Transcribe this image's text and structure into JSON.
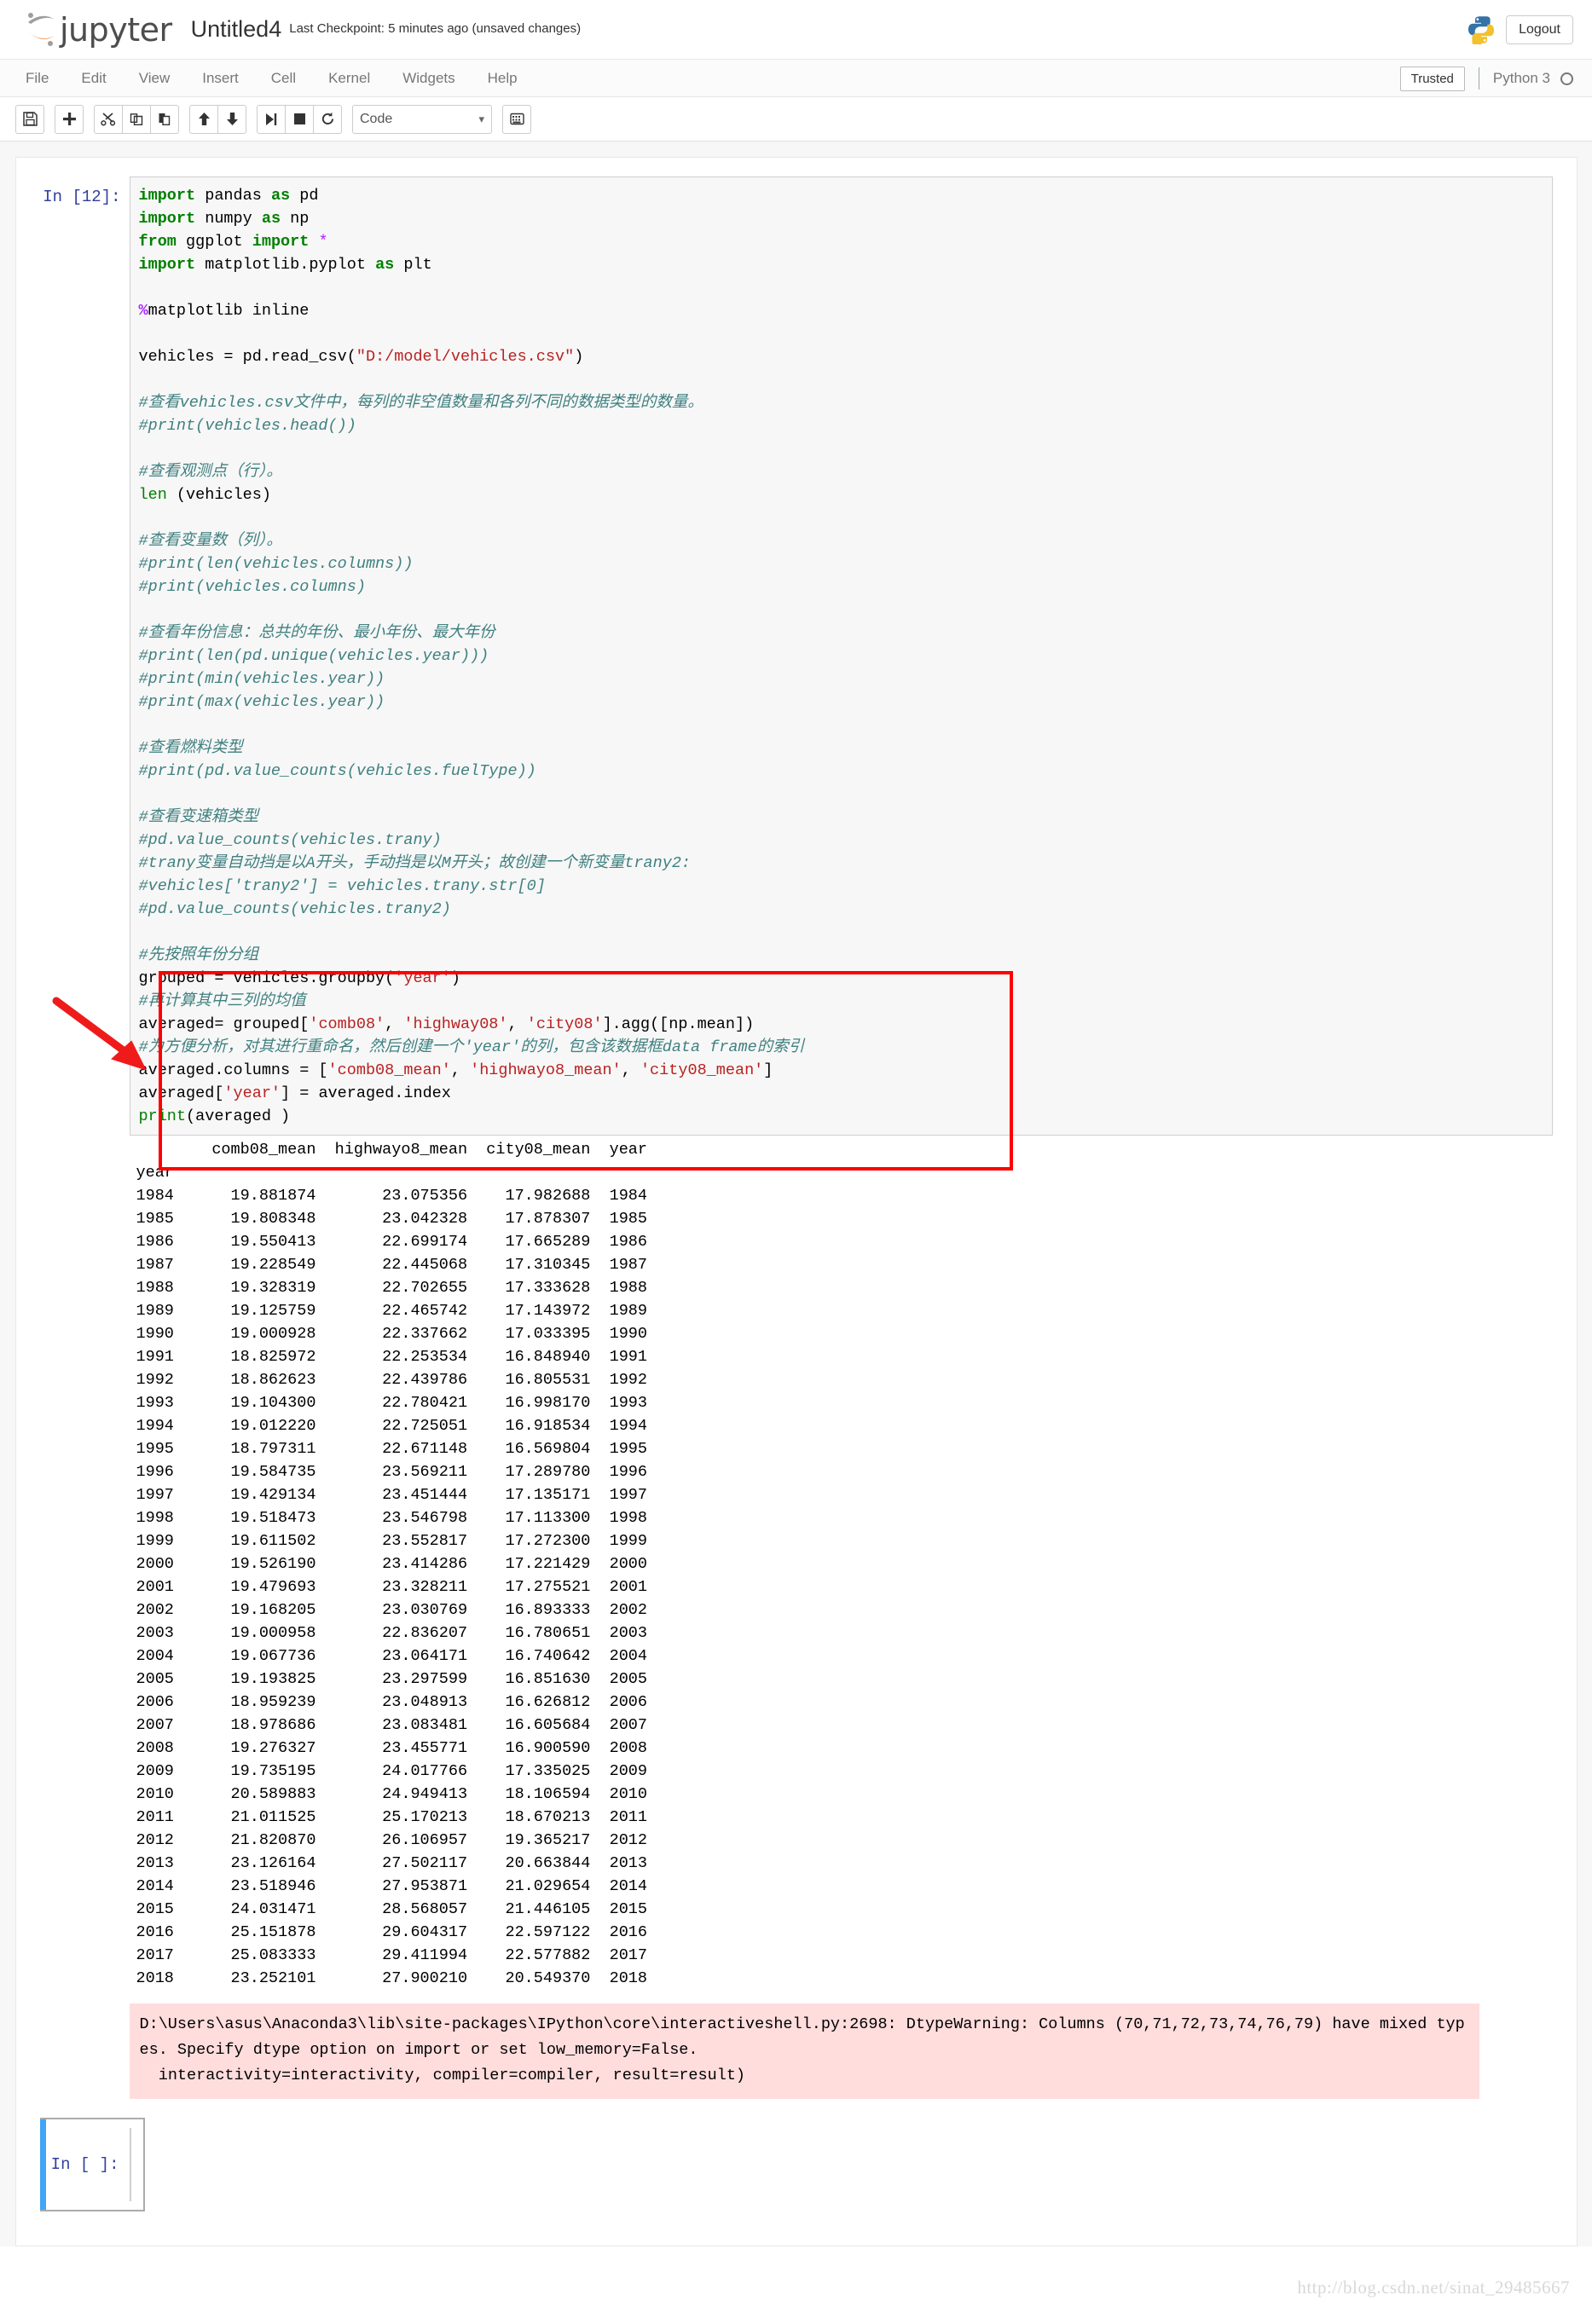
{
  "header": {
    "brand": "jupyter",
    "notebook_name": "Untitled4",
    "checkpoint": "Last Checkpoint: 5 minutes ago (unsaved changes)",
    "logout_label": "Logout"
  },
  "menubar": {
    "items": [
      "File",
      "Edit",
      "View",
      "Insert",
      "Cell",
      "Kernel",
      "Widgets",
      "Help"
    ],
    "trusted_label": "Trusted",
    "kernel_label": "Python 3"
  },
  "toolbar": {
    "cell_type": "Code",
    "icons": [
      "save-icon",
      "add-cell-icon",
      "cut-icon",
      "copy-icon",
      "paste-icon",
      "move-up-icon",
      "move-down-icon",
      "run-icon",
      "stop-icon",
      "restart-icon",
      "command-palette-icon"
    ]
  },
  "cells": [
    {
      "prompt": "In [12]:",
      "source_lines": [
        {
          "t": "kw",
          "v": "import"
        },
        {
          "t": "p",
          "v": " pandas "
        },
        {
          "t": "kw",
          "v": "as"
        },
        {
          "t": "p",
          "v": " pd"
        }
      ]
    }
  ],
  "code": {
    "prompt_in_12": "In [12]:",
    "prompt_empty": "In [ ]:"
  },
  "output": {
    "table_header": "        comb08_mean  highwayo8_mean  city08_mean  year",
    "index_label": "year",
    "columns": [
      "comb08_mean",
      "highwayo8_mean",
      "city08_mean",
      "year"
    ],
    "rows": [
      {
        "year": "1984",
        "comb08_mean": "19.881874",
        "highwayo8_mean": "23.075356",
        "city08_mean": "17.982688",
        "year_col": "1984"
      },
      {
        "year": "1985",
        "comb08_mean": "19.808348",
        "highwayo8_mean": "23.042328",
        "city08_mean": "17.878307",
        "year_col": "1985"
      },
      {
        "year": "1986",
        "comb08_mean": "19.550413",
        "highwayo8_mean": "22.699174",
        "city08_mean": "17.665289",
        "year_col": "1986"
      },
      {
        "year": "1987",
        "comb08_mean": "19.228549",
        "highwayo8_mean": "22.445068",
        "city08_mean": "17.310345",
        "year_col": "1987"
      },
      {
        "year": "1988",
        "comb08_mean": "19.328319",
        "highwayo8_mean": "22.702655",
        "city08_mean": "17.333628",
        "year_col": "1988"
      },
      {
        "year": "1989",
        "comb08_mean": "19.125759",
        "highwayo8_mean": "22.465742",
        "city08_mean": "17.143972",
        "year_col": "1989"
      },
      {
        "year": "1990",
        "comb08_mean": "19.000928",
        "highwayo8_mean": "22.337662",
        "city08_mean": "17.033395",
        "year_col": "1990"
      },
      {
        "year": "1991",
        "comb08_mean": "18.825972",
        "highwayo8_mean": "22.253534",
        "city08_mean": "16.848940",
        "year_col": "1991"
      },
      {
        "year": "1992",
        "comb08_mean": "18.862623",
        "highwayo8_mean": "22.439786",
        "city08_mean": "16.805531",
        "year_col": "1992"
      },
      {
        "year": "1993",
        "comb08_mean": "19.104300",
        "highwayo8_mean": "22.780421",
        "city08_mean": "16.998170",
        "year_col": "1993"
      },
      {
        "year": "1994",
        "comb08_mean": "19.012220",
        "highwayo8_mean": "22.725051",
        "city08_mean": "16.918534",
        "year_col": "1994"
      },
      {
        "year": "1995",
        "comb08_mean": "18.797311",
        "highwayo8_mean": "22.671148",
        "city08_mean": "16.569804",
        "year_col": "1995"
      },
      {
        "year": "1996",
        "comb08_mean": "19.584735",
        "highwayo8_mean": "23.569211",
        "city08_mean": "17.289780",
        "year_col": "1996"
      },
      {
        "year": "1997",
        "comb08_mean": "19.429134",
        "highwayo8_mean": "23.451444",
        "city08_mean": "17.135171",
        "year_col": "1997"
      },
      {
        "year": "1998",
        "comb08_mean": "19.518473",
        "highwayo8_mean": "23.546798",
        "city08_mean": "17.113300",
        "year_col": "1998"
      },
      {
        "year": "1999",
        "comb08_mean": "19.611502",
        "highwayo8_mean": "23.552817",
        "city08_mean": "17.272300",
        "year_col": "1999"
      },
      {
        "year": "2000",
        "comb08_mean": "19.526190",
        "highwayo8_mean": "23.414286",
        "city08_mean": "17.221429",
        "year_col": "2000"
      },
      {
        "year": "2001",
        "comb08_mean": "19.479693",
        "highwayo8_mean": "23.328211",
        "city08_mean": "17.275521",
        "year_col": "2001"
      },
      {
        "year": "2002",
        "comb08_mean": "19.168205",
        "highwayo8_mean": "23.030769",
        "city08_mean": "16.893333",
        "year_col": "2002"
      },
      {
        "year": "2003",
        "comb08_mean": "19.000958",
        "highwayo8_mean": "22.836207",
        "city08_mean": "16.780651",
        "year_col": "2003"
      },
      {
        "year": "2004",
        "comb08_mean": "19.067736",
        "highwayo8_mean": "23.064171",
        "city08_mean": "16.740642",
        "year_col": "2004"
      },
      {
        "year": "2005",
        "comb08_mean": "19.193825",
        "highwayo8_mean": "23.297599",
        "city08_mean": "16.851630",
        "year_col": "2005"
      },
      {
        "year": "2006",
        "comb08_mean": "18.959239",
        "highwayo8_mean": "23.048913",
        "city08_mean": "16.626812",
        "year_col": "2006"
      },
      {
        "year": "2007",
        "comb08_mean": "18.978686",
        "highwayo8_mean": "23.083481",
        "city08_mean": "16.605684",
        "year_col": "2007"
      },
      {
        "year": "2008",
        "comb08_mean": "19.276327",
        "highwayo8_mean": "23.455771",
        "city08_mean": "16.900590",
        "year_col": "2008"
      },
      {
        "year": "2009",
        "comb08_mean": "19.735195",
        "highwayo8_mean": "24.017766",
        "city08_mean": "17.335025",
        "year_col": "2009"
      },
      {
        "year": "2010",
        "comb08_mean": "20.589883",
        "highwayo8_mean": "24.949413",
        "city08_mean": "18.106594",
        "year_col": "2010"
      },
      {
        "year": "2011",
        "comb08_mean": "21.011525",
        "highwayo8_mean": "25.170213",
        "city08_mean": "18.670213",
        "year_col": "2011"
      },
      {
        "year": "2012",
        "comb08_mean": "21.820870",
        "highwayo8_mean": "26.106957",
        "city08_mean": "19.365217",
        "year_col": "2012"
      },
      {
        "year": "2013",
        "comb08_mean": "23.126164",
        "highwayo8_mean": "27.502117",
        "city08_mean": "20.663844",
        "year_col": "2013"
      },
      {
        "year": "2014",
        "comb08_mean": "23.518946",
        "highwayo8_mean": "27.953871",
        "city08_mean": "21.029654",
        "year_col": "2014"
      },
      {
        "year": "2015",
        "comb08_mean": "24.031471",
        "highwayo8_mean": "28.568057",
        "city08_mean": "21.446105",
        "year_col": "2015"
      },
      {
        "year": "2016",
        "comb08_mean": "25.151878",
        "highwayo8_mean": "29.604317",
        "city08_mean": "22.597122",
        "year_col": "2016"
      },
      {
        "year": "2017",
        "comb08_mean": "25.083333",
        "highwayo8_mean": "29.411994",
        "city08_mean": "22.577882",
        "year_col": "2017"
      },
      {
        "year": "2018",
        "comb08_mean": "23.252101",
        "highwayo8_mean": "27.900210",
        "city08_mean": "20.549370",
        "year_col": "2018"
      }
    ],
    "stdout_text": "        comb08_mean  highwayo8_mean  city08_mean  year\nyear                                                    \n1984      19.881874       23.075356    17.982688  1984\n1985      19.808348       23.042328    17.878307  1985\n1986      19.550413       22.699174    17.665289  1986\n1987      19.228549       22.445068    17.310345  1987\n1988      19.328319       22.702655    17.333628  1988\n1989      19.125759       22.465742    17.143972  1989\n1990      19.000928       22.337662    17.033395  1990\n1991      18.825972       22.253534    16.848940  1991\n1992      18.862623       22.439786    16.805531  1992\n1993      19.104300       22.780421    16.998170  1993\n1994      19.012220       22.725051    16.918534  1994\n1995      18.797311       22.671148    16.569804  1995\n1996      19.584735       23.569211    17.289780  1996\n1997      19.429134       23.451444    17.135171  1997\n1998      19.518473       23.546798    17.113300  1998\n1999      19.611502       23.552817    17.272300  1999\n2000      19.526190       23.414286    17.221429  2000\n2001      19.479693       23.328211    17.275521  2001\n2002      19.168205       23.030769    16.893333  2002\n2003      19.000958       22.836207    16.780651  2003\n2004      19.067736       23.064171    16.740642  2004\n2005      19.193825       23.297599    16.851630  2005\n2006      18.959239       23.048913    16.626812  2006\n2007      18.978686       23.083481    16.605684  2007\n2008      19.276327       23.455771    16.900590  2008\n2009      19.735195       24.017766    17.335025  2009\n2010      20.589883       24.949413    18.106594  2010\n2011      21.011525       25.170213    18.670213  2011\n2012      21.820870       26.106957    19.365217  2012\n2013      23.126164       27.502117    20.663844  2013\n2014      23.518946       27.953871    21.029654  2014\n2015      24.031471       28.568057    21.446105  2015\n2016      25.151878       29.604317    22.597122  2016\n2017      25.083333       29.411994    22.577882  2017\n2018      23.252101       27.900210    20.549370  2018",
    "warning_text": "D:\\Users\\asus\\Anaconda3\\lib\\site-packages\\IPython\\core\\interactiveshell.py:2698: DtypeWarning: Columns (70,71,72,73,74,76,79) have mixed types. Specify dtype option on import or set low_memory=False.\n  interactivity=interactivity, compiler=compiler, result=result)"
  },
  "watermark": "http://blog.csdn.net/sinat_29485667",
  "colors": {
    "highlight_box": "#ff0000",
    "arrow": "#ef1b1b",
    "selected_cell_bar": "#42A5F5",
    "prompt": "#303F9F",
    "warning_bg": "#fdd",
    "comment": "#408080",
    "keyword": "#008000",
    "string": "#BA2121",
    "magic": "#AA22FF"
  }
}
